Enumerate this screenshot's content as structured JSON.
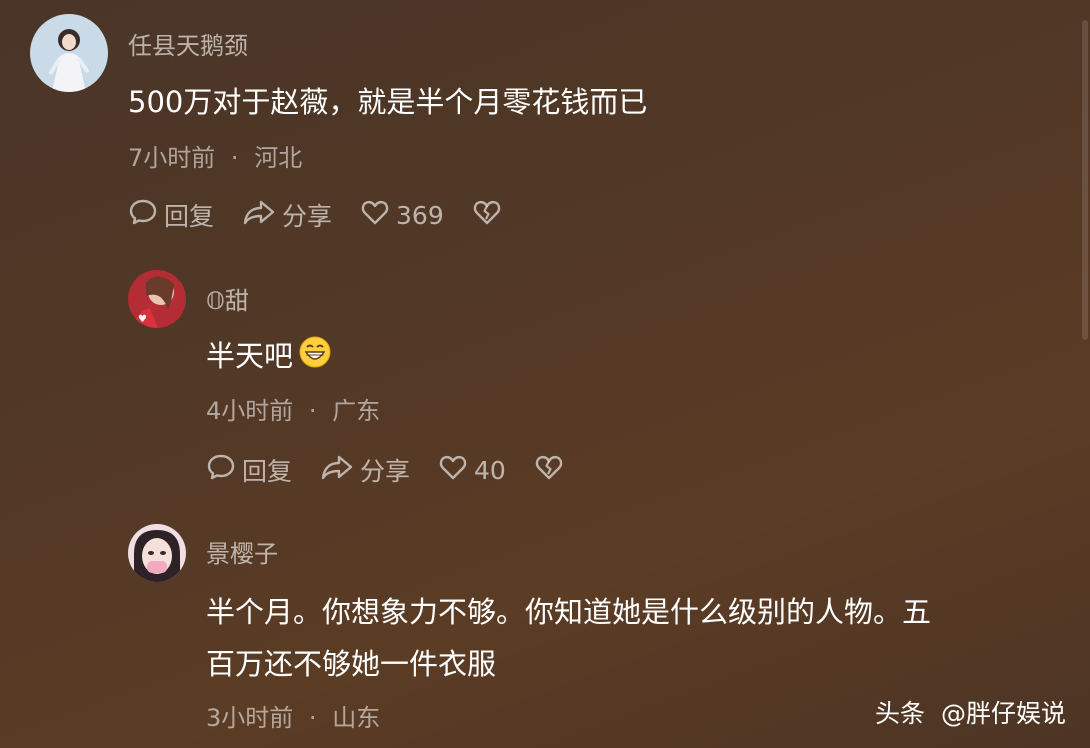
{
  "comments": [
    {
      "username": "任县天鹅颈",
      "text": "500万对于赵薇，就是半个月零花钱而已",
      "time": "7小时前",
      "location": "河北",
      "reply_label": "回复",
      "share_label": "分享",
      "likes": "369",
      "icons": [
        "comment-icon",
        "share-icon",
        "heart-icon",
        "broken-heart-icon"
      ]
    },
    {
      "username": "𝕆甜",
      "text": "半天吧",
      "emoji": "grinning-face-emoji",
      "time": "4小时前",
      "location": "广东",
      "reply_label": "回复",
      "share_label": "分享",
      "likes": "40"
    },
    {
      "username": "景樱子",
      "text_line1": "半个月。你想象力不够。你知道她是什么级别的人物。五",
      "text_line2": "百万还不够她一件衣服",
      "time": "3小时前",
      "location": "山东",
      "more_label": "···"
    }
  ],
  "separator": "·",
  "watermark": {
    "platform": "头条",
    "account": "@胖仔娱说"
  }
}
